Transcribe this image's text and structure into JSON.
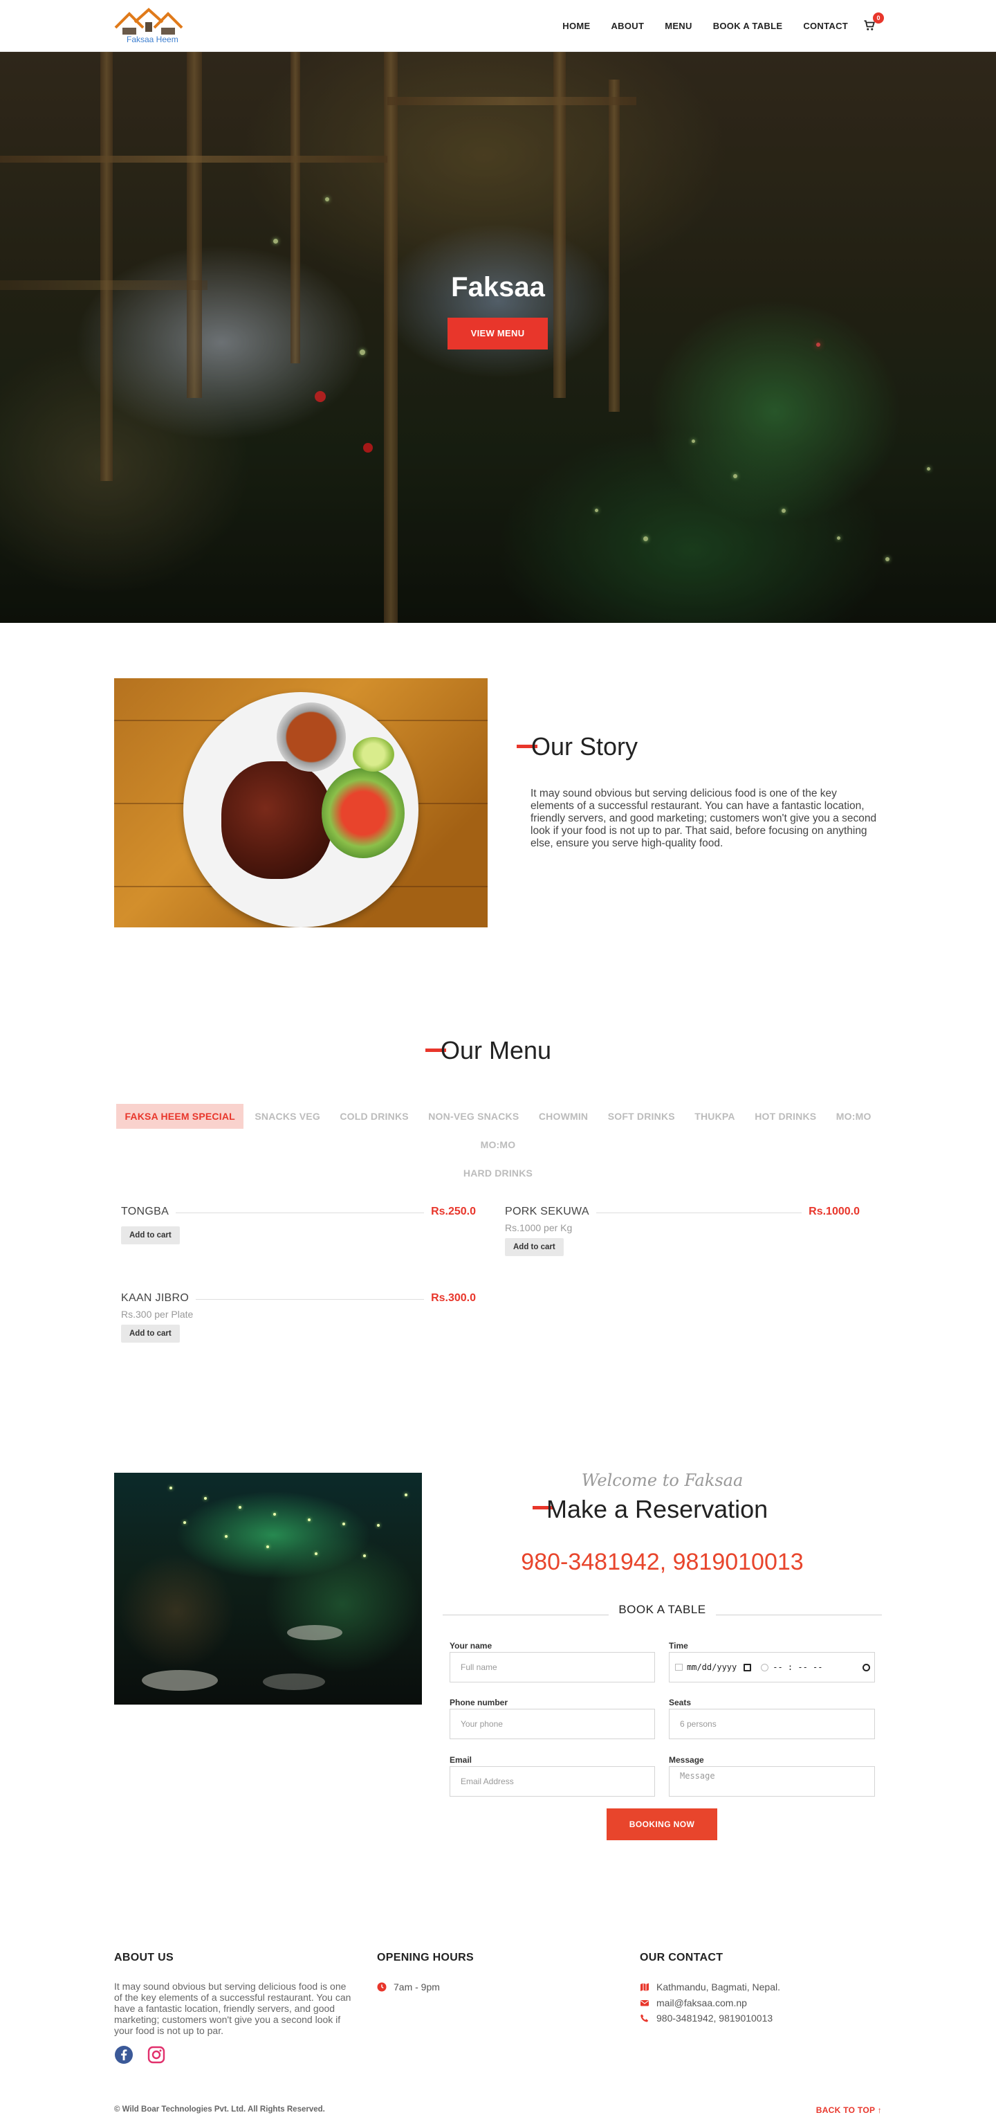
{
  "brand": {
    "logo_text": "Faksaa Heem"
  },
  "nav": {
    "items": [
      "HOME",
      "ABOUT",
      "MENU",
      "BOOK A TABLE",
      "CONTACT"
    ],
    "cart_count": "0",
    "cart_icon": "cart-icon"
  },
  "hero": {
    "title": "Faksaa",
    "button": "VIEW MENU"
  },
  "story": {
    "title": "Our Story",
    "text": "It may sound obvious but serving delicious food is one of the key elements of a successful restaurant. You can have a fantastic location, friendly servers, and good marketing; customers won't give you a second look if your food is not up to par. That said, before focusing on anything else, ensure you serve high-quality food."
  },
  "menu": {
    "title": "Our Menu",
    "tabs": [
      "FAKSA HEEM SPECIAL",
      "SNACKS VEG",
      "COLD DRINKS",
      "NON-VEG SNACKS",
      "CHOWMIN",
      "SOFT DRINKS",
      "THUKPA",
      "HOT DRINKS",
      "MO:MO",
      "MO:MO",
      "HARD DRINKS"
    ],
    "active_tab": "FAKSA HEEM SPECIAL",
    "items": [
      {
        "name": "TONGBA",
        "price": "Rs.250.0",
        "sub": "",
        "button": "Add to cart"
      },
      {
        "name": "PORK SEKUWA",
        "price": "Rs.1000.0",
        "sub": "Rs.1000 per Kg",
        "button": "Add to cart"
      },
      {
        "name": "KAAN JIBRO",
        "price": "Rs.300.0",
        "sub": "Rs.300 per Plate",
        "button": "Add to cart"
      }
    ]
  },
  "reservation": {
    "welcome": "Welcome to Faksaa",
    "title": "Make a Reservation",
    "phones": "980-3481942, 9819010013",
    "form_title": "BOOK A TABLE",
    "fields": {
      "name_label": "Your name",
      "name_placeholder": "Full name",
      "time_label": "Time",
      "date_placeholder": "mm/dd/yyyy",
      "time_placeholder": "-- : -- --",
      "phone_label": "Phone number",
      "phone_placeholder": "Your phone",
      "seats_label": "Seats",
      "seats_value": "6 persons",
      "email_label": "Email",
      "email_placeholder": "Email Address",
      "message_label": "Message",
      "message_placeholder": "Message"
    },
    "button": "BOOKING NOW"
  },
  "footer": {
    "about_title": "ABOUT US",
    "about_text": "It may sound obvious but serving delicious food is one of the key elements of a successful restaurant. You can have a fantastic location, friendly servers, and good marketing; customers won't give you a second look if your food is not up to par.",
    "hours_title": "OPENING HOURS",
    "hours": "7am - 9pm",
    "contact_title": "OUR CONTACT",
    "address": "Kathmandu, Bagmati, Nepal.",
    "email": "mail@faksaa.com.np",
    "phone": "980-3481942, 9819010013",
    "social": [
      "facebook-icon",
      "instagram-icon"
    ],
    "copyright": "© Wild Boar Technologies Pvt. Ltd. All Rights Reserved.",
    "back_to_top": "BACK TO TOP ↑"
  },
  "colors": {
    "accent": "#e8362b",
    "accent_tab_bg": "#f9d2cd",
    "phone_red": "#e8452c"
  }
}
